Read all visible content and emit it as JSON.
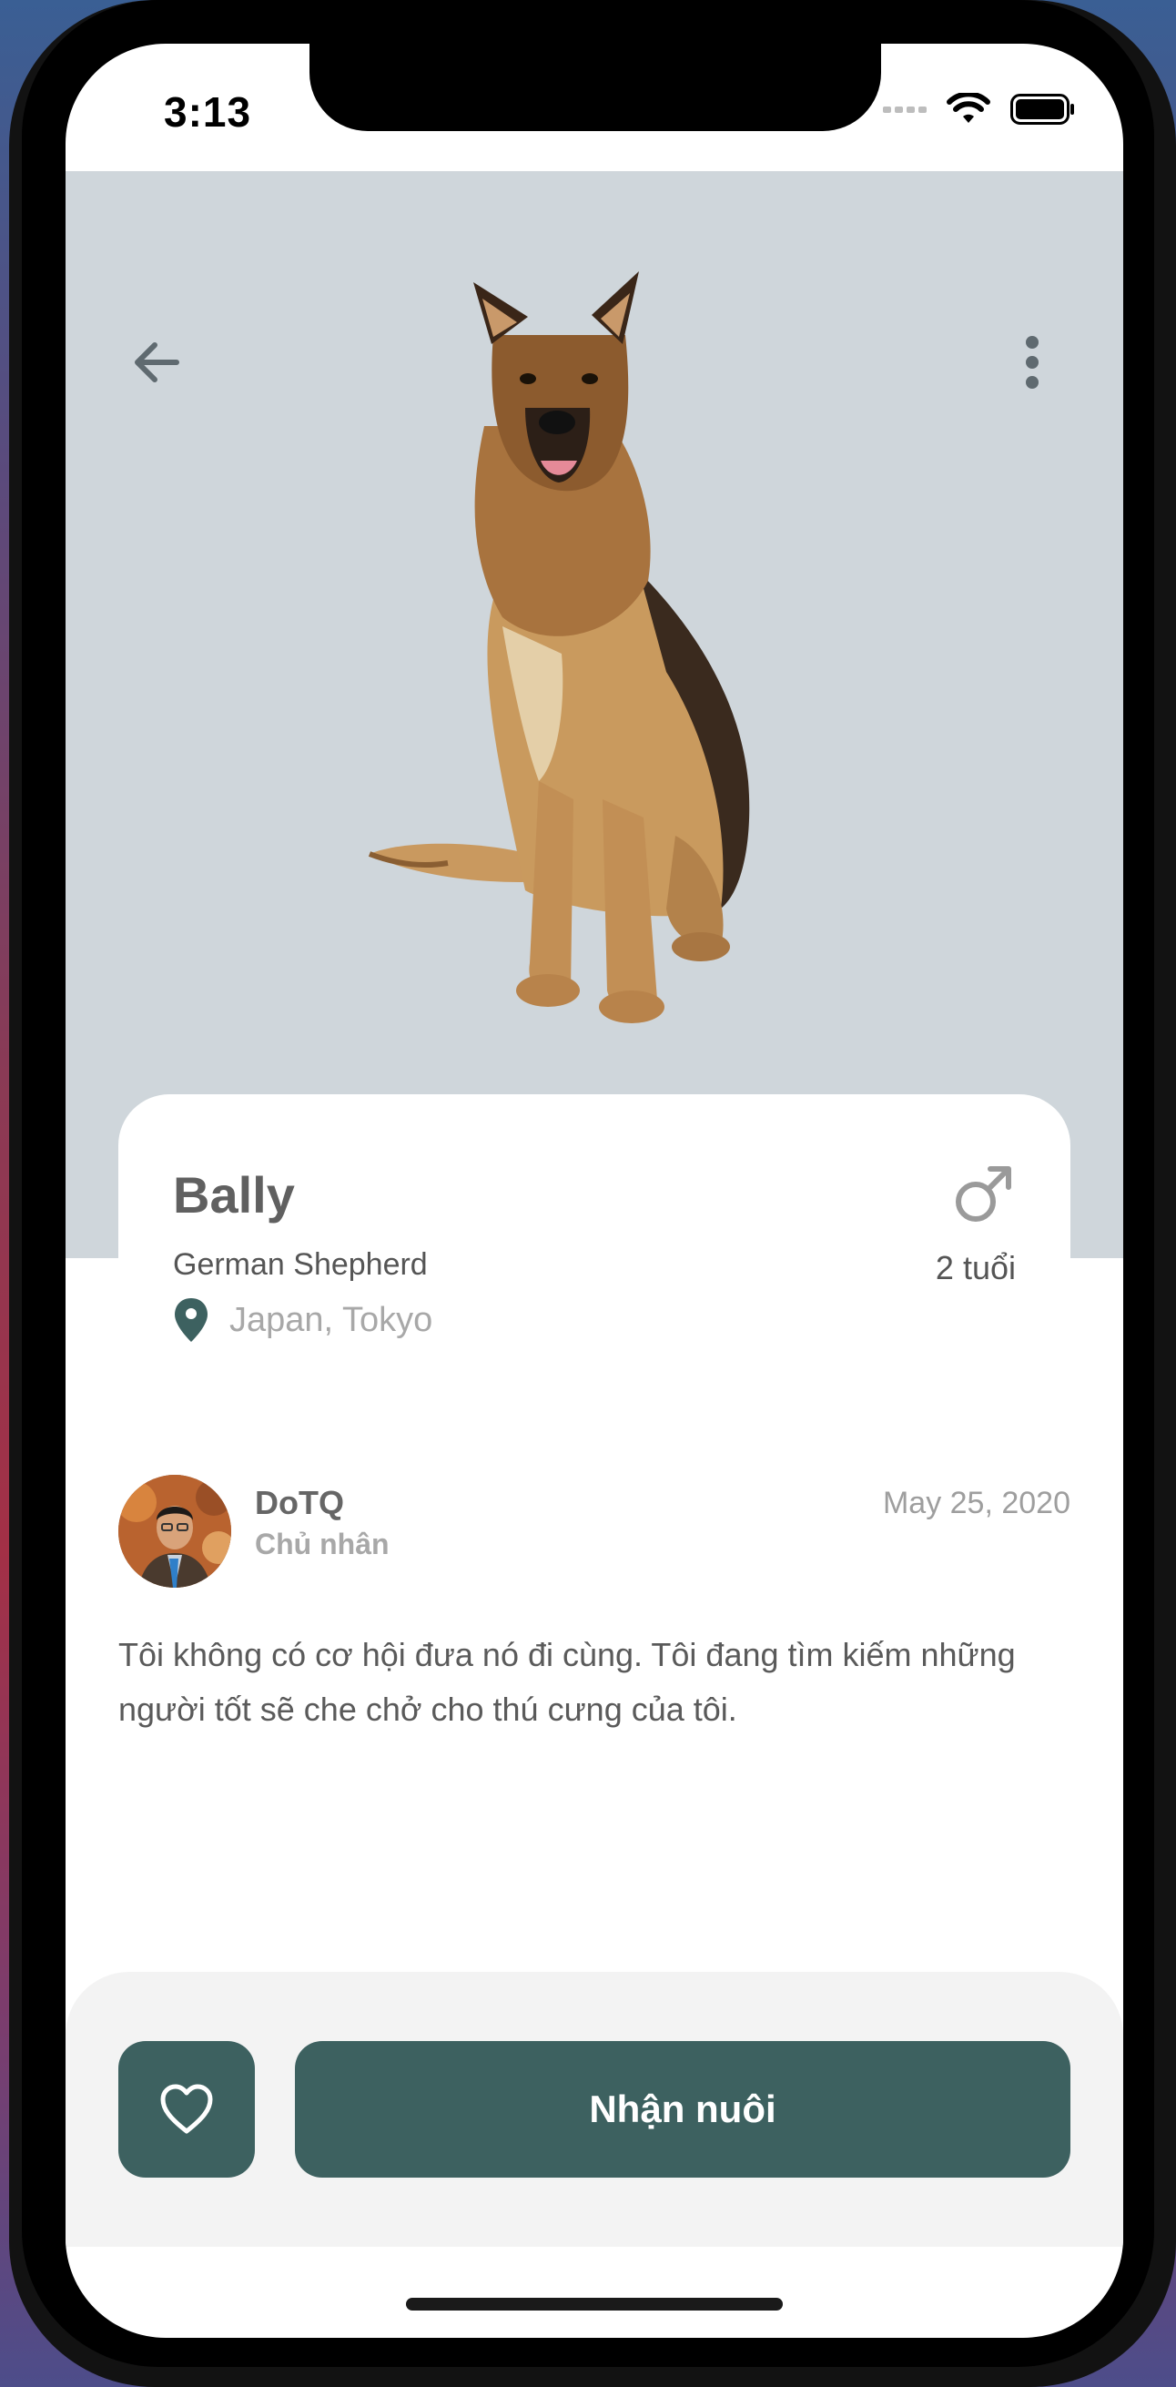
{
  "status_bar": {
    "time": "3:13"
  },
  "pet": {
    "name": "Bally",
    "breed": "German Shepherd",
    "location": "Japan, Tokyo",
    "gender_icon": "male-icon",
    "age": "2 tuổi"
  },
  "owner": {
    "name": "DoTQ",
    "role": "Chủ nhân",
    "date": "May 25, 2020",
    "description": "Tôi không có cơ hội đưa nó đi cùng. Tôi đang tìm kiếm những người tốt sẽ che chở cho thú cưng của tôi."
  },
  "actions": {
    "favorite_icon": "heart-icon",
    "adopt_label": "Nhận nuôi"
  },
  "colors": {
    "accent": "#3d6160",
    "hero_background": "#cfd6db",
    "location_pin": "#3d6160"
  }
}
